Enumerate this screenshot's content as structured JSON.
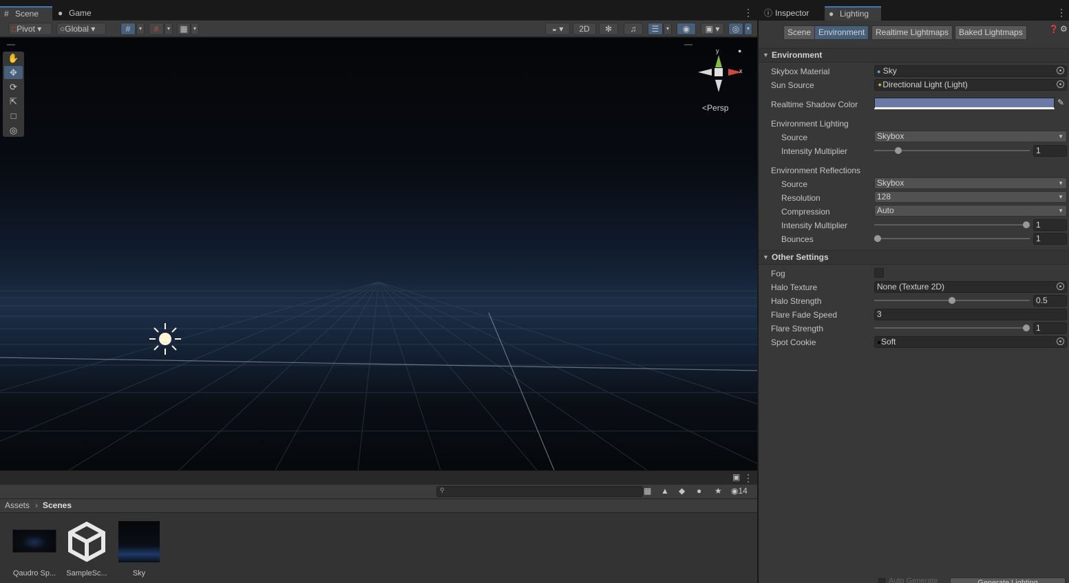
{
  "scene_window": {
    "tabs": [
      {
        "label": "Scene",
        "icon": "grid-icon"
      },
      {
        "label": "Game",
        "icon": "gamepad-icon"
      }
    ],
    "toolbar": {
      "pivot_label": "Pivot",
      "global_label": "Global",
      "mode_2d_label": "2D"
    },
    "tools": [
      "hand-tool",
      "move-tool",
      "rotate-tool",
      "scale-tool",
      "rect-tool",
      "transform-tool"
    ],
    "gizmo": {
      "x_label": "x",
      "y_label": "y",
      "projection_label": "Persp"
    }
  },
  "project_window": {
    "hidden_count": "14",
    "breadcrumb": [
      "Assets",
      "Scenes"
    ],
    "assets": [
      {
        "label": "Qaudro Sp..."
      },
      {
        "label": "SampleSc..."
      },
      {
        "label": "Sky"
      }
    ]
  },
  "right_window": {
    "tabs": [
      {
        "label": "Inspector",
        "icon": "info-icon"
      },
      {
        "label": "Lighting",
        "icon": "bulb-icon"
      }
    ],
    "segments": [
      "Scene",
      "Environment",
      "Realtime Lightmaps",
      "Baked Lightmaps"
    ],
    "active_segment": "Environment",
    "environment": {
      "header": "Environment",
      "skybox_material_label": "Skybox Material",
      "skybox_material_value": "Sky",
      "sun_source_label": "Sun Source",
      "sun_source_value": "Directional Light (Light)",
      "shadow_color_label": "Realtime Shadow Color",
      "shadow_color": "#6a7aa8",
      "env_lighting_label": "Environment Lighting",
      "lighting_source_label": "Source",
      "lighting_source_value": "Skybox",
      "lighting_intensity_label": "Intensity Multiplier",
      "lighting_intensity_value": "1",
      "lighting_intensity_fraction": 0.14,
      "env_reflections_label": "Environment Reflections",
      "refl_source_label": "Source",
      "refl_source_value": "Skybox",
      "resolution_label": "Resolution",
      "resolution_value": "128",
      "compression_label": "Compression",
      "compression_value": "Auto",
      "refl_intensity_label": "Intensity Multiplier",
      "refl_intensity_value": "1",
      "refl_intensity_fraction": 1.0,
      "bounces_label": "Bounces",
      "bounces_value": "1",
      "bounces_fraction": 0.0
    },
    "other_settings": {
      "header": "Other Settings",
      "fog_label": "Fog",
      "fog_checked": false,
      "halo_texture_label": "Halo Texture",
      "halo_texture_value": "None (Texture 2D)",
      "halo_strength_label": "Halo Strength",
      "halo_strength_value": "0.5",
      "halo_strength_fraction": 0.5,
      "flare_fade_label": "Flare Fade Speed",
      "flare_fade_value": "3",
      "flare_strength_label": "Flare Strength",
      "flare_strength_value": "1",
      "flare_strength_fraction": 1.0,
      "spot_cookie_label": "Spot Cookie",
      "spot_cookie_value": "Soft"
    },
    "footer": {
      "auto_generate_label": "Auto Generate",
      "generate_label": "Generate Lighting"
    }
  },
  "colors": {
    "accent": "#3a79bb",
    "selected": "#46607c",
    "gizmo_x": "#d0483a",
    "gizmo_y": "#7bc043"
  }
}
